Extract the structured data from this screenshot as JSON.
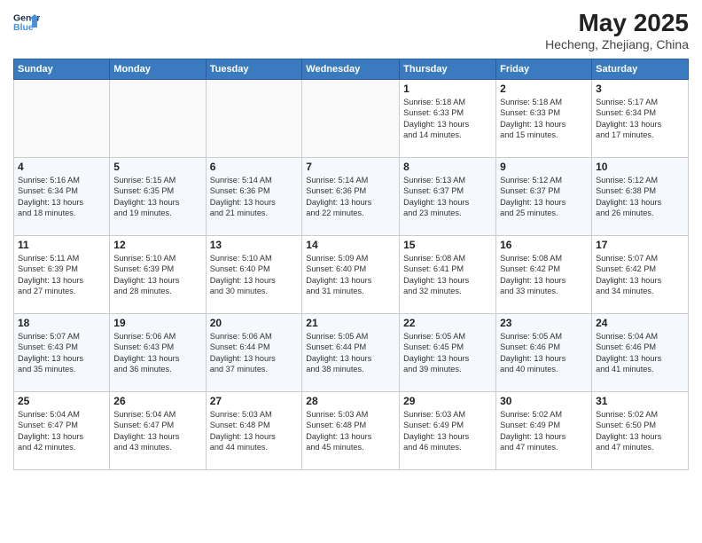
{
  "header": {
    "logo_general": "General",
    "logo_blue": "Blue",
    "month_year": "May 2025",
    "location": "Hecheng, Zhejiang, China"
  },
  "weekdays": [
    "Sunday",
    "Monday",
    "Tuesday",
    "Wednesday",
    "Thursday",
    "Friday",
    "Saturday"
  ],
  "weeks": [
    [
      {
        "day": "",
        "info": ""
      },
      {
        "day": "",
        "info": ""
      },
      {
        "day": "",
        "info": ""
      },
      {
        "day": "",
        "info": ""
      },
      {
        "day": "1",
        "info": "Sunrise: 5:18 AM\nSunset: 6:33 PM\nDaylight: 13 hours\nand 14 minutes."
      },
      {
        "day": "2",
        "info": "Sunrise: 5:18 AM\nSunset: 6:33 PM\nDaylight: 13 hours\nand 15 minutes."
      },
      {
        "day": "3",
        "info": "Sunrise: 5:17 AM\nSunset: 6:34 PM\nDaylight: 13 hours\nand 17 minutes."
      }
    ],
    [
      {
        "day": "4",
        "info": "Sunrise: 5:16 AM\nSunset: 6:34 PM\nDaylight: 13 hours\nand 18 minutes."
      },
      {
        "day": "5",
        "info": "Sunrise: 5:15 AM\nSunset: 6:35 PM\nDaylight: 13 hours\nand 19 minutes."
      },
      {
        "day": "6",
        "info": "Sunrise: 5:14 AM\nSunset: 6:36 PM\nDaylight: 13 hours\nand 21 minutes."
      },
      {
        "day": "7",
        "info": "Sunrise: 5:14 AM\nSunset: 6:36 PM\nDaylight: 13 hours\nand 22 minutes."
      },
      {
        "day": "8",
        "info": "Sunrise: 5:13 AM\nSunset: 6:37 PM\nDaylight: 13 hours\nand 23 minutes."
      },
      {
        "day": "9",
        "info": "Sunrise: 5:12 AM\nSunset: 6:37 PM\nDaylight: 13 hours\nand 25 minutes."
      },
      {
        "day": "10",
        "info": "Sunrise: 5:12 AM\nSunset: 6:38 PM\nDaylight: 13 hours\nand 26 minutes."
      }
    ],
    [
      {
        "day": "11",
        "info": "Sunrise: 5:11 AM\nSunset: 6:39 PM\nDaylight: 13 hours\nand 27 minutes."
      },
      {
        "day": "12",
        "info": "Sunrise: 5:10 AM\nSunset: 6:39 PM\nDaylight: 13 hours\nand 28 minutes."
      },
      {
        "day": "13",
        "info": "Sunrise: 5:10 AM\nSunset: 6:40 PM\nDaylight: 13 hours\nand 30 minutes."
      },
      {
        "day": "14",
        "info": "Sunrise: 5:09 AM\nSunset: 6:40 PM\nDaylight: 13 hours\nand 31 minutes."
      },
      {
        "day": "15",
        "info": "Sunrise: 5:08 AM\nSunset: 6:41 PM\nDaylight: 13 hours\nand 32 minutes."
      },
      {
        "day": "16",
        "info": "Sunrise: 5:08 AM\nSunset: 6:42 PM\nDaylight: 13 hours\nand 33 minutes."
      },
      {
        "day": "17",
        "info": "Sunrise: 5:07 AM\nSunset: 6:42 PM\nDaylight: 13 hours\nand 34 minutes."
      }
    ],
    [
      {
        "day": "18",
        "info": "Sunrise: 5:07 AM\nSunset: 6:43 PM\nDaylight: 13 hours\nand 35 minutes."
      },
      {
        "day": "19",
        "info": "Sunrise: 5:06 AM\nSunset: 6:43 PM\nDaylight: 13 hours\nand 36 minutes."
      },
      {
        "day": "20",
        "info": "Sunrise: 5:06 AM\nSunset: 6:44 PM\nDaylight: 13 hours\nand 37 minutes."
      },
      {
        "day": "21",
        "info": "Sunrise: 5:05 AM\nSunset: 6:44 PM\nDaylight: 13 hours\nand 38 minutes."
      },
      {
        "day": "22",
        "info": "Sunrise: 5:05 AM\nSunset: 6:45 PM\nDaylight: 13 hours\nand 39 minutes."
      },
      {
        "day": "23",
        "info": "Sunrise: 5:05 AM\nSunset: 6:46 PM\nDaylight: 13 hours\nand 40 minutes."
      },
      {
        "day": "24",
        "info": "Sunrise: 5:04 AM\nSunset: 6:46 PM\nDaylight: 13 hours\nand 41 minutes."
      }
    ],
    [
      {
        "day": "25",
        "info": "Sunrise: 5:04 AM\nSunset: 6:47 PM\nDaylight: 13 hours\nand 42 minutes."
      },
      {
        "day": "26",
        "info": "Sunrise: 5:04 AM\nSunset: 6:47 PM\nDaylight: 13 hours\nand 43 minutes."
      },
      {
        "day": "27",
        "info": "Sunrise: 5:03 AM\nSunset: 6:48 PM\nDaylight: 13 hours\nand 44 minutes."
      },
      {
        "day": "28",
        "info": "Sunrise: 5:03 AM\nSunset: 6:48 PM\nDaylight: 13 hours\nand 45 minutes."
      },
      {
        "day": "29",
        "info": "Sunrise: 5:03 AM\nSunset: 6:49 PM\nDaylight: 13 hours\nand 46 minutes."
      },
      {
        "day": "30",
        "info": "Sunrise: 5:02 AM\nSunset: 6:49 PM\nDaylight: 13 hours\nand 47 minutes."
      },
      {
        "day": "31",
        "info": "Sunrise: 5:02 AM\nSunset: 6:50 PM\nDaylight: 13 hours\nand 47 minutes."
      }
    ]
  ]
}
